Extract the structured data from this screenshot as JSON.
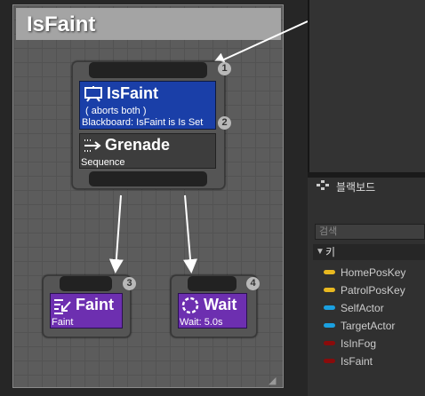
{
  "comment": {
    "title": "IsFaint"
  },
  "decorator": {
    "title": "IsFaint",
    "aborts": "( aborts both )",
    "condition": "Blackboard: IsFaint is Is Set",
    "color": "#1a3fa8"
  },
  "composite": {
    "title": "Grenade",
    "type": "Sequence"
  },
  "tasks": [
    {
      "title": "Faint",
      "detail": "Faint",
      "color": "#6d2fb0"
    },
    {
      "title": "Wait",
      "detail": "Wait: 5.0s",
      "color": "#6d2fb0"
    }
  ],
  "badges": [
    "1",
    "2",
    "3",
    "4"
  ],
  "blackboard": {
    "tab_label": "블랙보드",
    "search_placeholder": "검색",
    "keys_header": "키",
    "keys": [
      {
        "name": "HomePosKey",
        "color": "#e8b820"
      },
      {
        "name": "PatrolPosKey",
        "color": "#e8b820"
      },
      {
        "name": "SelfActor",
        "color": "#1aa0e0"
      },
      {
        "name": "TargetActor",
        "color": "#1aa0e0"
      },
      {
        "name": "IsInFog",
        "color": "#8a0b0b"
      },
      {
        "name": "IsFaint",
        "color": "#8a0b0b"
      }
    ]
  }
}
